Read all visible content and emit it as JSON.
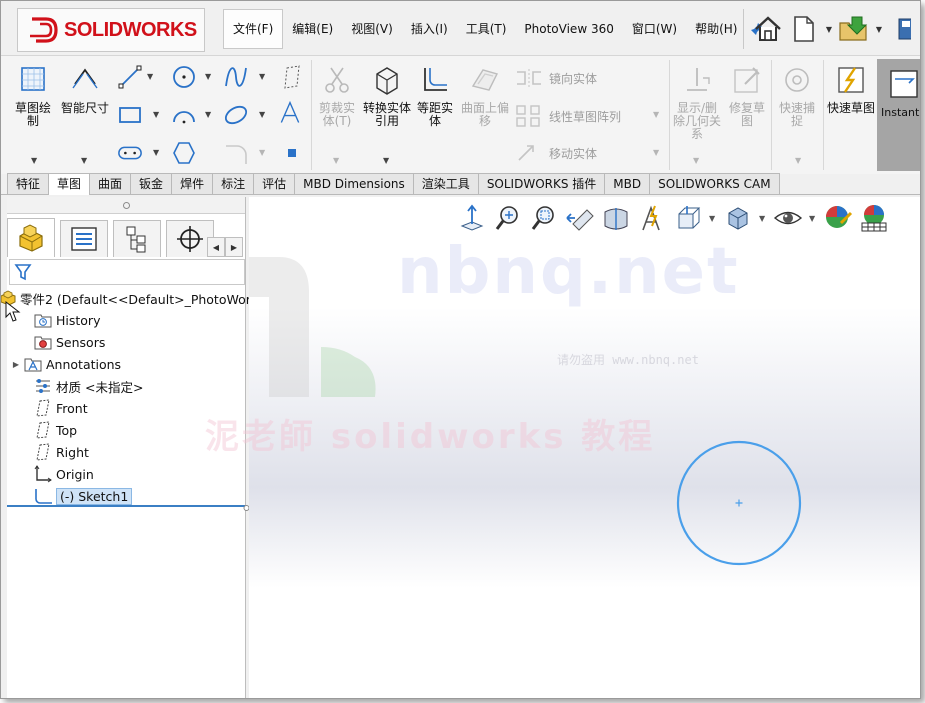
{
  "app": {
    "brand": "SOLIDWORKS"
  },
  "menu": {
    "items": [
      "文件(F)",
      "编辑(E)",
      "视图(V)",
      "插入(I)",
      "工具(T)",
      "PhotoView 360",
      "窗口(W)",
      "帮助(H)"
    ]
  },
  "ribbon": {
    "sketch": "草图绘制",
    "smart_dimension": "智能尺寸",
    "trim": "剪裁实体(T)",
    "convert": "转换实体引用",
    "offset": "等距实体",
    "offset_surface": "曲面上偏移",
    "mirror": "镜向实体",
    "linear_pattern": "线性草图阵列",
    "move": "移动实体",
    "display_relations": "显示/删除几何关系",
    "repair": "修复草图",
    "quick_snaps": "快速捕捉",
    "rapid_sketch": "快速草图",
    "instant": "Instant"
  },
  "tabs": [
    "特征",
    "草图",
    "曲面",
    "钣金",
    "焊件",
    "标注",
    "评估",
    "MBD Dimensions",
    "渲染工具",
    "SOLIDWORKS 插件",
    "MBD",
    "SOLIDWORKS CAM"
  ],
  "tree": {
    "root": "零件2  (Default<<Default>_PhotoWor",
    "items": {
      "history": "History",
      "sensors": "Sensors",
      "annotations": "Annotations",
      "material": "材质 <未指定>",
      "front": "Front",
      "top": "Top",
      "right": "Right",
      "origin": "Origin",
      "sketch1": "(-) Sketch1"
    }
  },
  "watermark": {
    "main": "nbnq.net",
    "sub": "请勿盗用 www.nbnq.net",
    "cn": "泥老師 solidworks 教程"
  },
  "colors": {
    "brand_red": "#d1111a",
    "sketch_blue": "#4a9fea",
    "selection": "#cfe3f7"
  }
}
